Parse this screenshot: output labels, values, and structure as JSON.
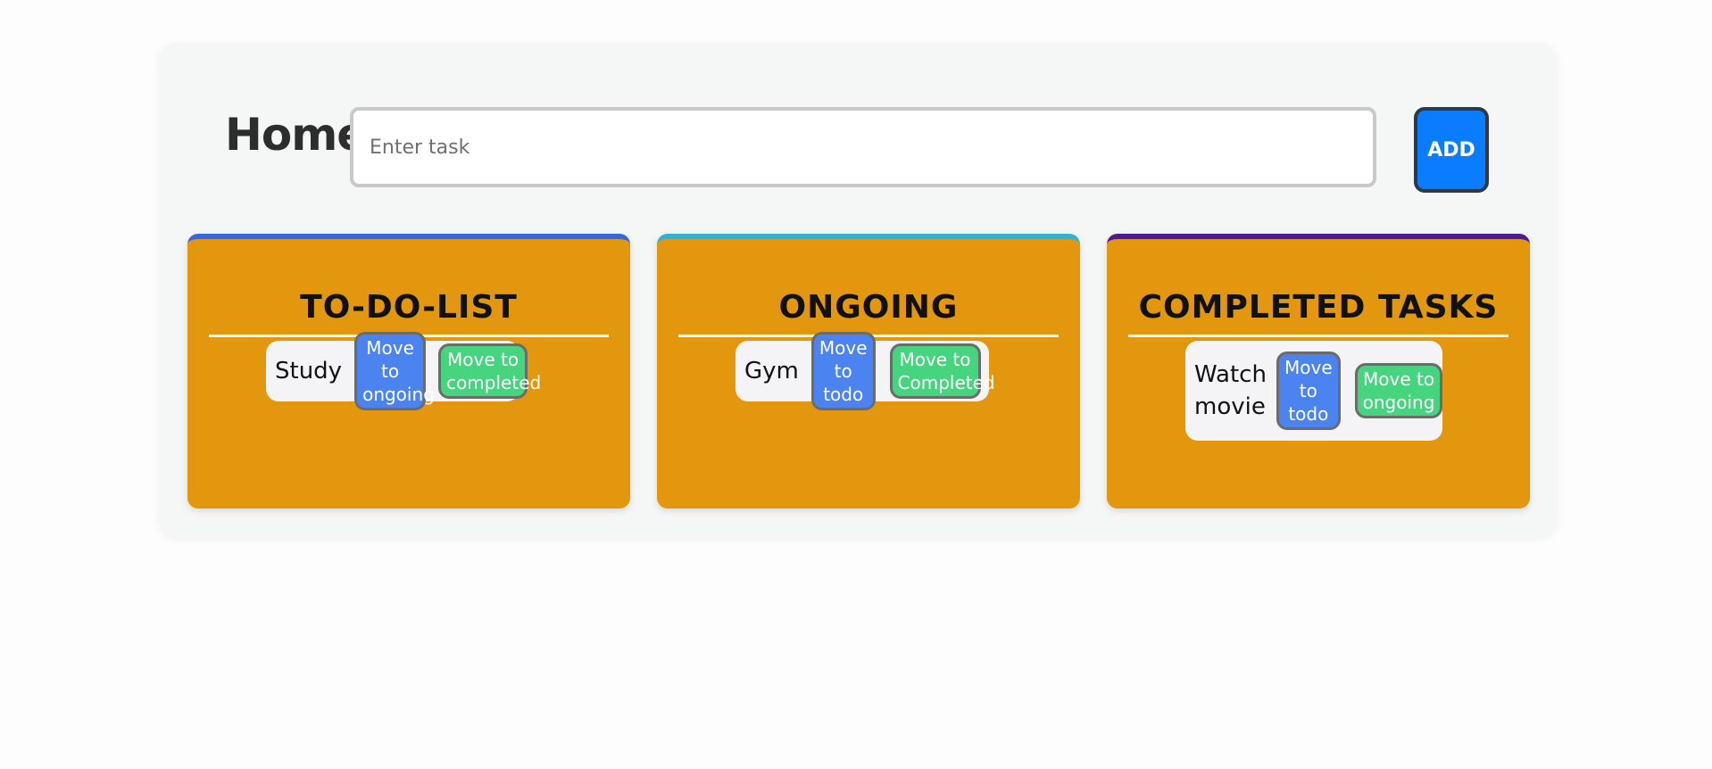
{
  "header": {
    "title": "Home",
    "input_placeholder": "Enter task",
    "input_value": "",
    "add_label": "ADD"
  },
  "columns": [
    {
      "title": "TO-DO-LIST",
      "accent": "#3566e6",
      "tasks": [
        {
          "name": "Study",
          "actions": [
            "Move to ongoing",
            "Move to completed"
          ]
        }
      ]
    },
    {
      "title": "ONGOING",
      "accent": "#2bb4d8",
      "tasks": [
        {
          "name": "Gym",
          "actions": [
            "Move to todo",
            "Move to Completed"
          ]
        }
      ]
    },
    {
      "title": "COMPLETED TASKS",
      "accent": "#4a1a9a",
      "tasks": [
        {
          "name": "Watch movie",
          "actions": [
            "Move to todo",
            "Move to ongoing"
          ]
        }
      ]
    }
  ],
  "colors": {
    "column_bg": "#e3970f",
    "add_button": "#0a7cff",
    "blue_button": "#4b83f0",
    "green_button": "#47d47e"
  }
}
